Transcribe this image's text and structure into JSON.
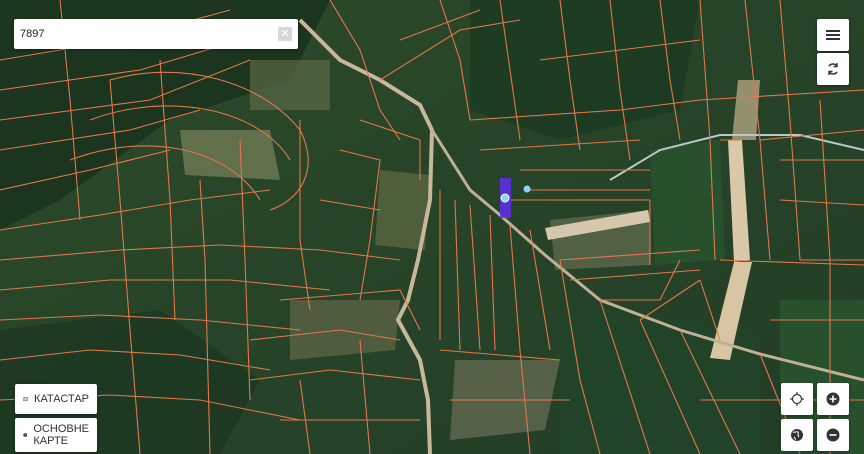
{
  "search": {
    "value": "7897",
    "clear_icon": "close-icon"
  },
  "controls": {
    "menu_icon": "menu-icon",
    "refresh_icon": "refresh-icon",
    "locate_icon": "crosshair-icon",
    "zoom_in_icon": "plus-icon",
    "globe_icon": "globe-icon",
    "zoom_out_icon": "minus-icon"
  },
  "layers": {
    "cadastre_label": "КАТАСТАР",
    "base_maps_label": "ОСНОВНЕ КАРТЕ"
  },
  "colors": {
    "parcel_lines": "#e2774a",
    "highlight": "#5b31e0",
    "marker": "#8fd3f5"
  }
}
